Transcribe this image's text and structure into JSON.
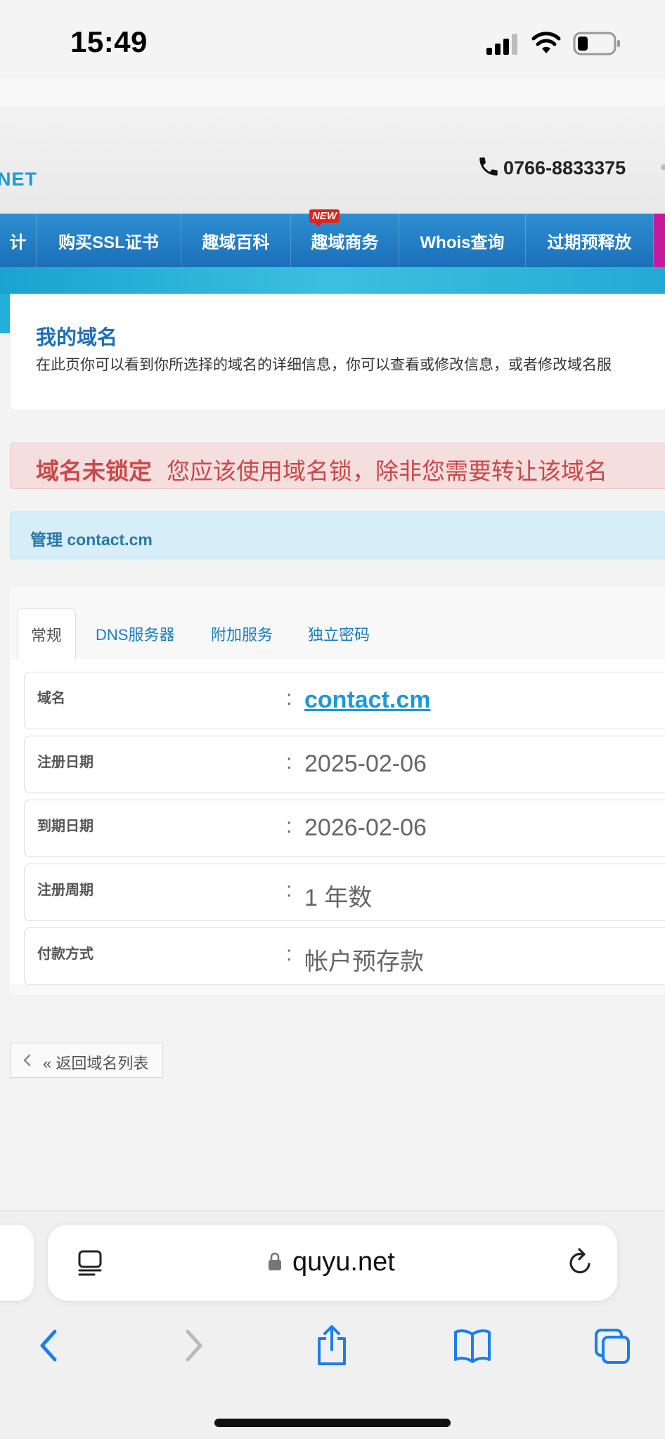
{
  "status_bar": {
    "time": "15:49"
  },
  "header": {
    "logo_text": "NET",
    "phone": "0766-8833375"
  },
  "nav": {
    "items": [
      {
        "label": "计",
        "width": 52
      },
      {
        "label": "购买SSL证书",
        "width": 206
      },
      {
        "label": "趣域百科",
        "width": 156
      },
      {
        "label": "趣域商务",
        "width": 154,
        "badge": "NEW"
      },
      {
        "label": "Whois查询",
        "width": 180
      },
      {
        "label": "过期预释放",
        "width": 182
      }
    ]
  },
  "intro": {
    "title": "我的域名",
    "description": "在此页你可以看到你所选择的域名的详细信息，你可以查看或修改信息，或者修改域名服"
  },
  "alert": {
    "strong": "域名未锁定",
    "message": "您应该使用域名锁，除非您需要转让该域名"
  },
  "manage": {
    "label": "管理 contact.cm"
  },
  "tabs": [
    {
      "label": "常规",
      "active": true
    },
    {
      "label": "DNS服务器",
      "active": false
    },
    {
      "label": "附加服务",
      "active": false
    },
    {
      "label": "独立密码",
      "active": false
    }
  ],
  "details": [
    {
      "label": "域名",
      "value": "contact.cm",
      "link": true
    },
    {
      "label": "注册日期",
      "value": "2025-02-06",
      "link": false
    },
    {
      "label": "到期日期",
      "value": "2026-02-06",
      "link": false
    },
    {
      "label": "注册周期",
      "value": "1 年数",
      "link": false
    },
    {
      "label": "付款方式",
      "value": "帐户预存款",
      "link": false
    }
  ],
  "back_button": {
    "label": "« 返回域名列表"
  },
  "browser": {
    "url": "quyu.net",
    "icons": [
      "reader-icon",
      "lock-icon",
      "reload-icon",
      "back-icon",
      "forward-icon",
      "share-icon",
      "bookmarks-icon",
      "tabs-icon"
    ]
  }
}
